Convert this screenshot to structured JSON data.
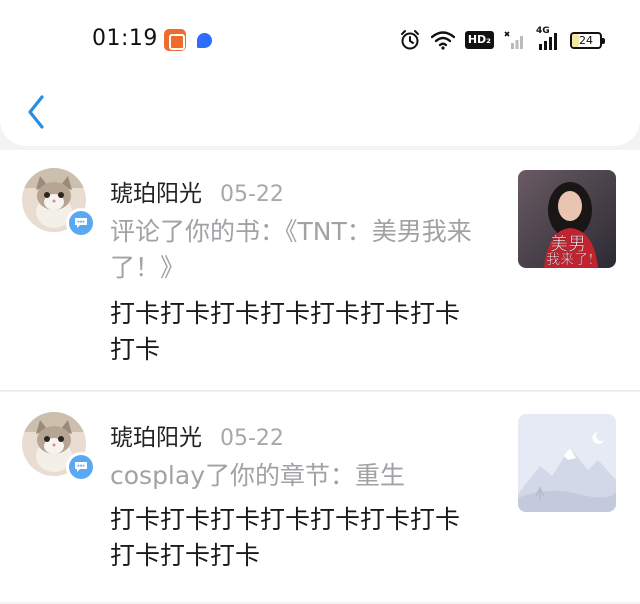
{
  "status_bar": {
    "time": "01:19",
    "hd_label": "HD₂",
    "network_label": "4G",
    "battery_level": "24"
  },
  "nav": {
    "back_icon": "chevron-left-icon"
  },
  "notifications": [
    {
      "username": "琥珀阳光",
      "date": "05-22",
      "action": "评论了你的书：《TNT：美男我来了！》",
      "content": "打卡打卡打卡打卡打卡打卡打卡打卡",
      "thumb_text": "美男我来了!"
    },
    {
      "username": "琥珀阳光",
      "date": "05-22",
      "action": "cosplay了你的章节：重生",
      "content": "打卡打卡打卡打卡打卡打卡打卡打卡打卡打卡"
    }
  ],
  "colors": {
    "accent": "#2a8fe0",
    "badge": "#5aa8f2",
    "muted_text": "#a2a2a6"
  }
}
